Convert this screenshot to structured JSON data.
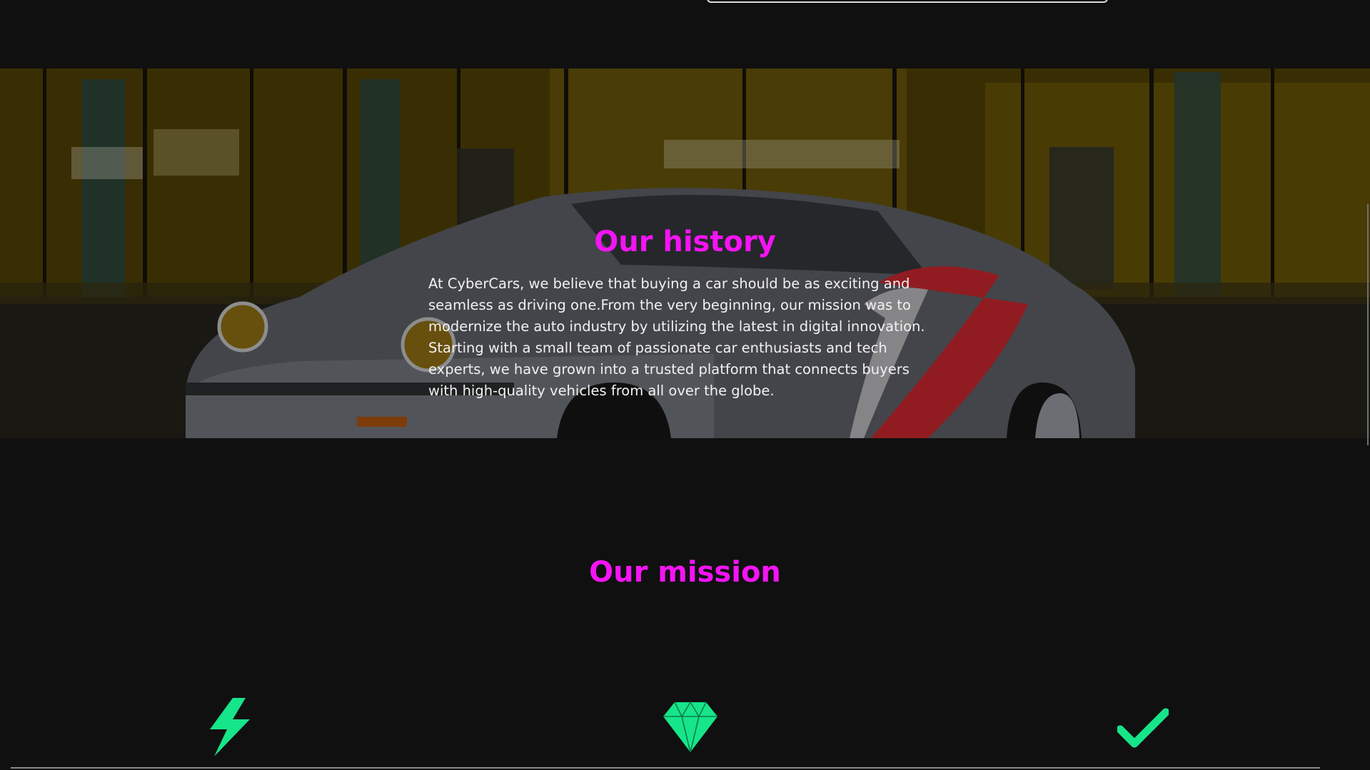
{
  "history": {
    "title": "Our history",
    "text": "At CyberCars, we believe that buying a car should be as exciting and seamless as driving one.From the very beginning, our mission was to modernize the auto industry by utilizing the latest in digital innovation. Starting with a small team of passionate car enthusiasts and tech experts, we have grown into a trusted platform that connects buyers with high-quality vehicles from all over the globe.",
    "background_image": "porsche-showroom-night"
  },
  "mission": {
    "title": "Our mission",
    "icons": [
      {
        "name": "bolt-icon",
        "color": "#16e58a"
      },
      {
        "name": "gem-icon",
        "color": "#16e58a"
      },
      {
        "name": "check-icon",
        "color": "#16e58a"
      }
    ]
  },
  "colors": {
    "background": "#101010",
    "accent_heading": "#f414f4",
    "icon_green": "#16e58a",
    "body_text": "#f1f1f1"
  }
}
